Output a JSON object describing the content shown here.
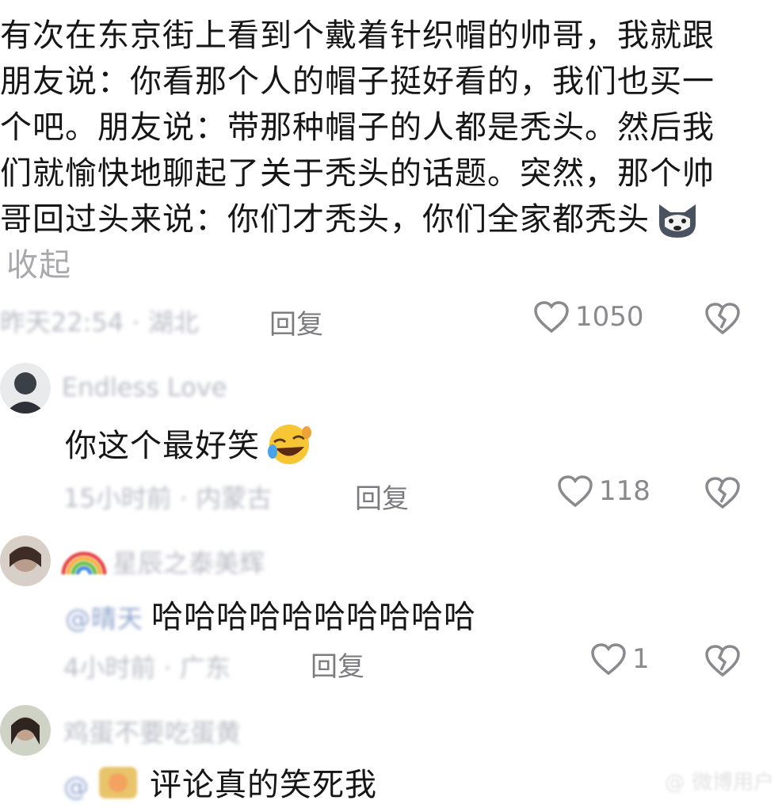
{
  "main_comment": {
    "text": "有次在东京街上看到个戴着针织帽的帅哥，我就跟朋友说：你看那个人的帽子挺好看的，我们也买一个吧。朋友说：带那种帽子的人都是秃头。然后我们就愉快地聊起了关于秃头的话题。突然，那个帅哥回过头来说：你们才秃头，你们全家都秃头",
    "collapse_label": "收起",
    "meta": "昨天22:54 · 湖北",
    "reply_label": "回复",
    "likes": "1050",
    "emoji": "dog-face-emoji"
  },
  "comments": [
    {
      "username": "Endless Love",
      "text": "你这个最好笑",
      "emoji": "rolling-laughing-emoji",
      "meta": "15小时前 · 内蒙古",
      "reply_label": "回复",
      "likes": "118"
    },
    {
      "username": "星辰之泰美辉",
      "mention": "@晴天",
      "text": "哈哈哈哈哈哈哈哈哈哈",
      "meta": "4小时前 · 广东",
      "reply_label": "回复",
      "likes": "1"
    },
    {
      "username": "鸡蛋不要吃蛋黄",
      "mention": "@",
      "text": "评论真的笑死我"
    }
  ],
  "watermark": "@ 微博用户",
  "colors": {
    "text": "#161616",
    "muted": "#7c7c80",
    "collapse": "#a9a9ad",
    "icon": "#8a8a8e"
  }
}
